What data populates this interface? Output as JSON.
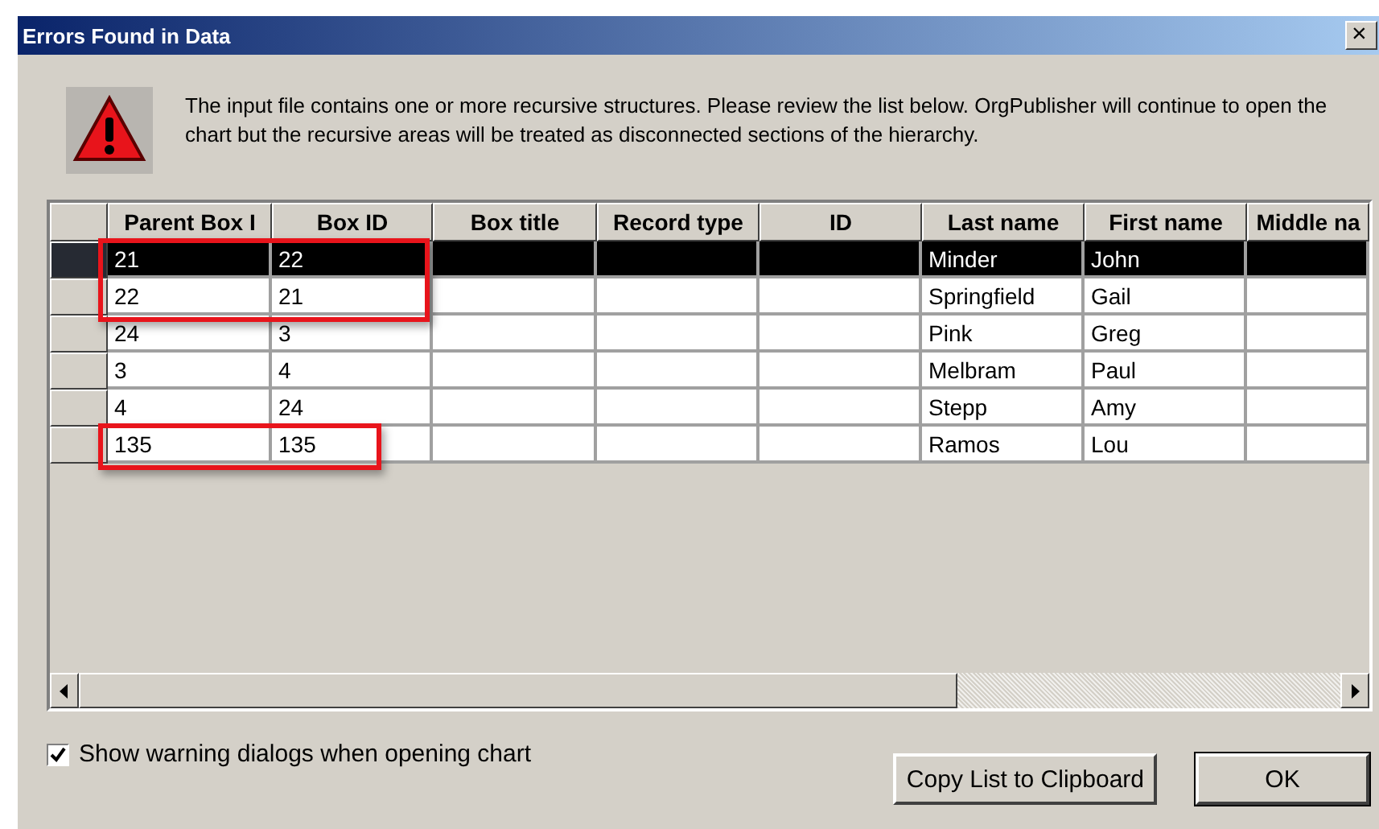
{
  "window": {
    "title": "Errors Found in Data",
    "close": "×"
  },
  "message": "The input file contains one or more recursive structures. Please review the list below. OrgPublisher will continue to open the chart but the recursive areas will be treated as disconnected sections of the hierarchy.",
  "table": {
    "columns": [
      "Parent Box I",
      "Box ID",
      "Box title",
      "Record type",
      "ID",
      "Last name",
      "First name",
      "Middle na"
    ],
    "rows": [
      {
        "parent_box_id": "21",
        "box_id": "22",
        "last_name": "Minder",
        "first_name": "John",
        "selected": true,
        "highlighted": true
      },
      {
        "parent_box_id": "22",
        "box_id": "21",
        "last_name": "Springfield",
        "first_name": "Gail",
        "selected": false,
        "highlighted": true
      },
      {
        "parent_box_id": "24",
        "box_id": "3",
        "last_name": "Pink",
        "first_name": "Greg",
        "selected": false,
        "highlighted": false
      },
      {
        "parent_box_id": "3",
        "box_id": "4",
        "last_name": "Melbram",
        "first_name": "Paul",
        "selected": false,
        "highlighted": false
      },
      {
        "parent_box_id": "4",
        "box_id": "24",
        "last_name": "Stepp",
        "first_name": "Amy",
        "selected": false,
        "highlighted": false
      },
      {
        "parent_box_id": "135",
        "box_id": "135",
        "last_name": "Ramos",
        "first_name": "Lou",
        "selected": false,
        "highlighted": true
      }
    ]
  },
  "checkbox": {
    "label": "Show warning dialogs when opening chart",
    "checked": true
  },
  "buttons": [
    {
      "label": "Copy List to Clipboard",
      "default": false
    },
    {
      "label": "OK",
      "default": true
    }
  ]
}
